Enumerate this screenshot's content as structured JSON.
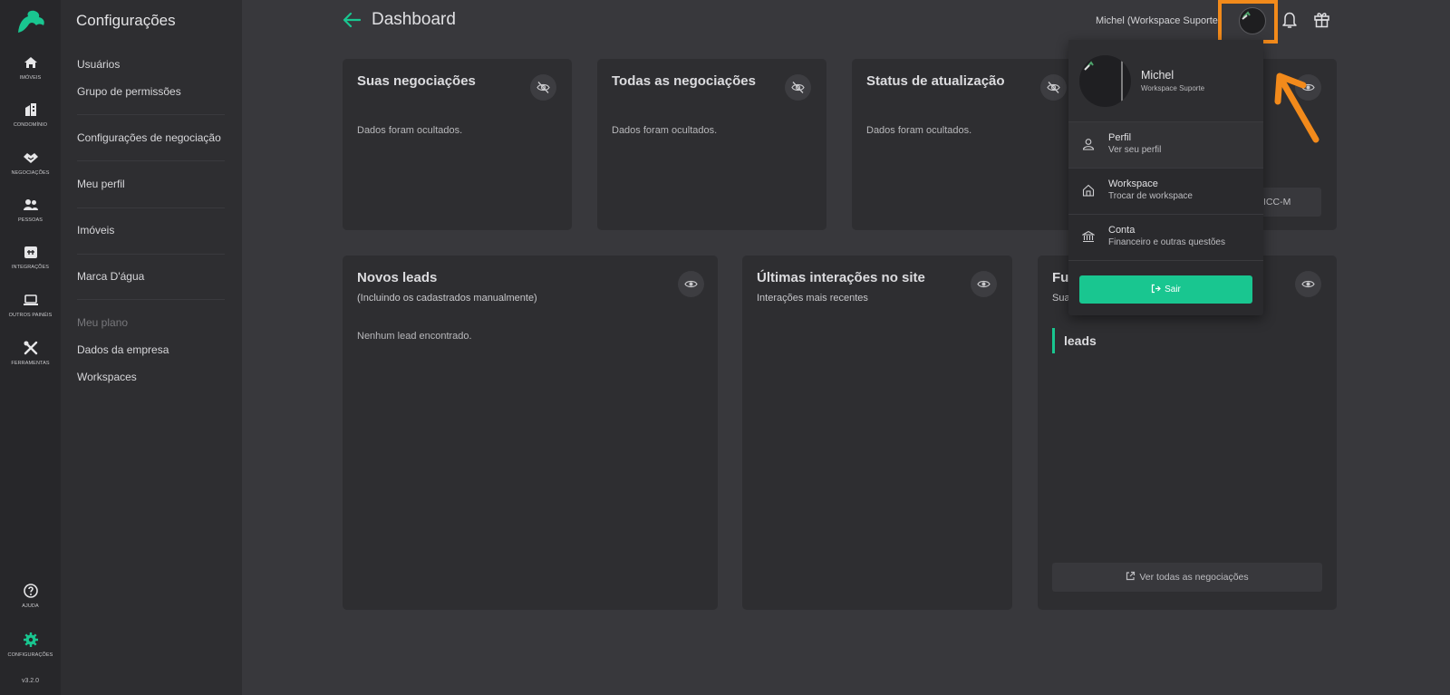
{
  "rail": {
    "items": [
      {
        "label": "Imóveis",
        "icon": "home-icon"
      },
      {
        "label": "Condomínio",
        "icon": "building-icon"
      },
      {
        "label": "Negociações",
        "icon": "handshake-icon"
      },
      {
        "label": "Pessoas",
        "icon": "people-icon"
      },
      {
        "label": "Integrações",
        "icon": "plug-icon"
      },
      {
        "label": "Outros Painéis",
        "icon": "laptop-icon"
      },
      {
        "label": "Ferramentas",
        "icon": "tools-icon"
      }
    ],
    "help_label": "Ajuda",
    "settings_label": "Configurações",
    "version": "v3.2.0"
  },
  "sidebar": {
    "title": "Configurações",
    "links": [
      "Usuários",
      "Grupo de permissões",
      "Configurações de negociação",
      "Meu perfil",
      "Imóveis",
      "Marca D'água",
      "Meu plano",
      "Dados da empresa",
      "Workspaces"
    ]
  },
  "header": {
    "title": "Dashboard",
    "user_label": "Michel (Workspace Suporte)"
  },
  "cards": {
    "suas": {
      "title": "Suas negociações",
      "body": "Dados foram ocultados."
    },
    "todas": {
      "title": "Todas as negociações",
      "body": "Dados foram ocultados."
    },
    "status": {
      "title": "Status de atualização",
      "body": "Dados foram ocultados."
    },
    "icc_button": "ICC-M",
    "novos": {
      "title": "Novos leads",
      "subtitle": "(Incluindo os cadastrados manualmente)",
      "body": "Nenhum lead encontrado."
    },
    "ultimas": {
      "title": "Últimas interações no site",
      "subtitle": "Interações mais recentes"
    },
    "funil": {
      "title": "Fu",
      "subtitle": "Sua",
      "tag": "leads",
      "button": "Ver todas as negociações"
    }
  },
  "dropdown": {
    "name": "Michel",
    "workspace": "Workspace Suporte",
    "items": [
      {
        "title": "Perfil",
        "subtitle": "Ver seu perfil"
      },
      {
        "title": "Workspace",
        "subtitle": "Trocar de workspace"
      },
      {
        "title": "Conta",
        "subtitle": "Financeiro e outras questões"
      }
    ],
    "logout": "Sair"
  },
  "colors": {
    "accent": "#19c690",
    "highlight": "#f28a1b",
    "background": "#38383c",
    "panel": "#2e2e31"
  }
}
